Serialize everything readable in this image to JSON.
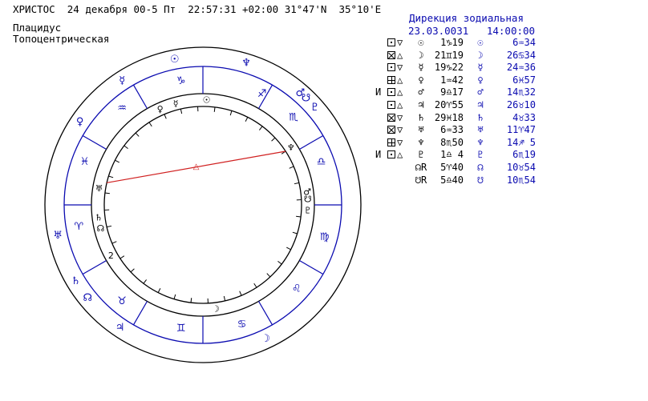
{
  "header": {
    "name": "ХРИСТОС",
    "date": "24 декабря 00-5 Пт",
    "time": "22:57:31",
    "tz": "+02:00",
    "lat": "31°47'N",
    "lon": "35°10'E"
  },
  "house_system": "Плацидус",
  "chart_kind": "Топоцентрическая",
  "direction": {
    "title": "Дирекция зодиальная",
    "date": "23.03.0031",
    "time": "14:00:00"
  },
  "aspects_table": [
    {
      "mark": "",
      "aspects": [
        "□",
        "▽"
      ],
      "planet1": "☉",
      "pos1": "1♑19",
      "planet2": "☉",
      "pos2": "6♒34"
    },
    {
      "mark": "",
      "aspects": [
        "⊠",
        "△"
      ],
      "planet1": "☽",
      "pos1": "21♊19",
      "planet2": "☽",
      "pos2": "26♋34"
    },
    {
      "mark": "",
      "aspects": [
        "□",
        "▽"
      ],
      "planet1": "☿",
      "pos1": "19♑22",
      "planet2": "☿",
      "pos2": "24♒36"
    },
    {
      "mark": "",
      "aspects": [
        "⊞",
        "△"
      ],
      "planet1": "♀",
      "pos1": "1♒42",
      "planet2": "♀",
      "pos2": "6♓57"
    },
    {
      "mark": "И",
      "aspects": [
        "□",
        "△"
      ],
      "planet1": "♂",
      "pos1": "9♎17",
      "planet2": "♂",
      "pos2": "14♏32"
    },
    {
      "mark": "",
      "aspects": [
        "□",
        "△"
      ],
      "planet1": "♃",
      "pos1": "20♈55",
      "planet2": "♃",
      "pos2": "26♉10"
    },
    {
      "mark": "",
      "aspects": [
        "⊠",
        "▽"
      ],
      "planet1": "♄",
      "pos1": "29♓18",
      "planet2": "♄",
      "pos2": "4♉33"
    },
    {
      "mark": "",
      "aspects": [
        "⊠",
        "▽"
      ],
      "planet1": "♅",
      "pos1": "6♒33",
      "planet2": "♅",
      "pos2": "11♈47"
    },
    {
      "mark": "",
      "aspects": [
        "⊞",
        "▽"
      ],
      "planet1": "♆",
      "pos1": "8♏50",
      "planet2": "♆",
      "pos2": "14♐ 5"
    },
    {
      "mark": "И",
      "aspects": [
        "□",
        "△"
      ],
      "planet1": "♇",
      "pos1": "1♎ 4",
      "planet2": "♇",
      "pos2": "6♏19"
    },
    {
      "mark": "",
      "aspects": [],
      "planet1": "☊R",
      "pos1": "5♈40",
      "planet2": "☊",
      "pos2": "10♉54"
    },
    {
      "mark": "",
      "aspects": [],
      "planet1": "☋R",
      "pos1": "5♎40",
      "planet2": "☋",
      "pos2": "10♏54"
    }
  ],
  "wheel": {
    "zodiac_glyphs": [
      "♈",
      "♉",
      "♊",
      "♋",
      "♌",
      "♍",
      "♎",
      "♏",
      "♐",
      "♑",
      "♒",
      "♓"
    ],
    "outer_planets": [
      {
        "g": "♆",
        "name": "neptune"
      },
      {
        "g": "♐",
        "name": "sagittarius-marker"
      },
      {
        "g": "♂",
        "name": "mars"
      },
      {
        "g": "☋",
        "name": "south-node"
      },
      {
        "g": "♇",
        "name": "pluto"
      },
      {
        "g": "♑",
        "name": "capricorn-marker"
      },
      {
        "g": "☉",
        "name": "sun"
      },
      {
        "g": "☿",
        "name": "mercury"
      },
      {
        "g": "♀",
        "name": "venus"
      },
      {
        "g": "♅",
        "name": "uranus"
      },
      {
        "g": "♄",
        "name": "saturn"
      },
      {
        "g": "☊",
        "name": "north-node"
      },
      {
        "g": "♃",
        "name": "jupiter"
      },
      {
        "g": "☽",
        "name": "moon"
      }
    ],
    "inner_planets": [
      {
        "g": "☉",
        "name": "sun"
      },
      {
        "g": "☿",
        "name": "mercury"
      },
      {
        "g": "♀",
        "name": "venus"
      },
      {
        "g": "♅",
        "name": "uranus"
      },
      {
        "g": "♄",
        "name": "saturn"
      },
      {
        "g": "☊",
        "name": "north-node"
      },
      {
        "g": "2",
        "name": "house-2-label"
      },
      {
        "g": "☽",
        "name": "moon"
      },
      {
        "g": "♆",
        "name": "neptune"
      },
      {
        "g": "♂",
        "name": "mars"
      },
      {
        "g": "☋",
        "name": "south-node"
      },
      {
        "g": "♇",
        "name": "pluto"
      }
    ],
    "aspect_line_color": "#d02020",
    "ring_color": "#0a0ab0",
    "zodiac_color": "#0a0ab0",
    "aspect_symbol": "△"
  }
}
